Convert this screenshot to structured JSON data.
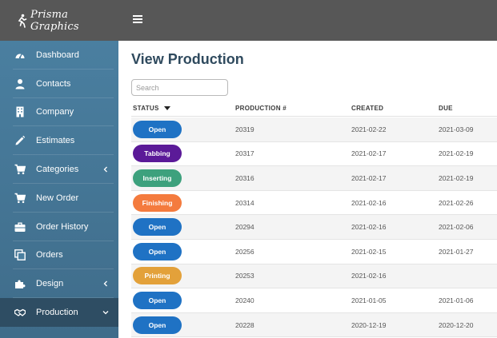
{
  "brand": {
    "name": "Prisma Graphics"
  },
  "sidebar": {
    "items": [
      {
        "label": "Dashboard",
        "icon": "dashboard-icon"
      },
      {
        "label": "Contacts",
        "icon": "user-icon"
      },
      {
        "label": "Company",
        "icon": "building-icon"
      },
      {
        "label": "Estimates",
        "icon": "pencil-icon"
      },
      {
        "label": "Categories",
        "icon": "cart-icon",
        "chevron": "left"
      },
      {
        "label": "New Order",
        "icon": "cart-icon"
      },
      {
        "label": "Order History",
        "icon": "briefcase-icon"
      },
      {
        "label": "Orders",
        "icon": "copy-icon"
      },
      {
        "label": "Design",
        "icon": "puzzle-icon",
        "chevron": "left"
      },
      {
        "label": "Production",
        "icon": "handshake-icon",
        "chevron": "down",
        "active": true
      }
    ]
  },
  "main": {
    "title": "View Production",
    "search": {
      "placeholder": "Search",
      "value": ""
    },
    "columns": {
      "status": "STATUS",
      "production": "PRODUCTION #",
      "created": "CREATED",
      "due": "DUE"
    },
    "rows": [
      {
        "status": "Open",
        "production": "20319",
        "created": "2021-02-22",
        "due": "2021-03-09"
      },
      {
        "status": "Tabbing",
        "production": "20317",
        "created": "2021-02-17",
        "due": "2021-02-19"
      },
      {
        "status": "Inserting",
        "production": "20316",
        "created": "2021-02-17",
        "due": "2021-02-19"
      },
      {
        "status": "Finishing",
        "production": "20314",
        "created": "2021-02-16",
        "due": "2021-02-26"
      },
      {
        "status": "Open",
        "production": "20294",
        "created": "2021-02-16",
        "due": "2021-02-06"
      },
      {
        "status": "Open",
        "production": "20256",
        "created": "2021-02-15",
        "due": "2021-01-27"
      },
      {
        "status": "Printing",
        "production": "20253",
        "created": "2021-02-16",
        "due": ""
      },
      {
        "status": "Open",
        "production": "20240",
        "created": "2021-01-05",
        "due": "2021-01-06"
      },
      {
        "status": "Open",
        "production": "20228",
        "created": "2020-12-19",
        "due": "2020-12-20"
      }
    ]
  },
  "colors": {
    "topbar": "#575757",
    "sidebar": "#4a7fa0",
    "sidebar_active": "#2e4d63",
    "title": "#2f4a5e",
    "status": {
      "Open": "#1f72c4",
      "Tabbing": "#5b1a98",
      "Inserting": "#3da17d",
      "Finishing": "#f47b3e",
      "Printing": "#e3a13a"
    }
  }
}
